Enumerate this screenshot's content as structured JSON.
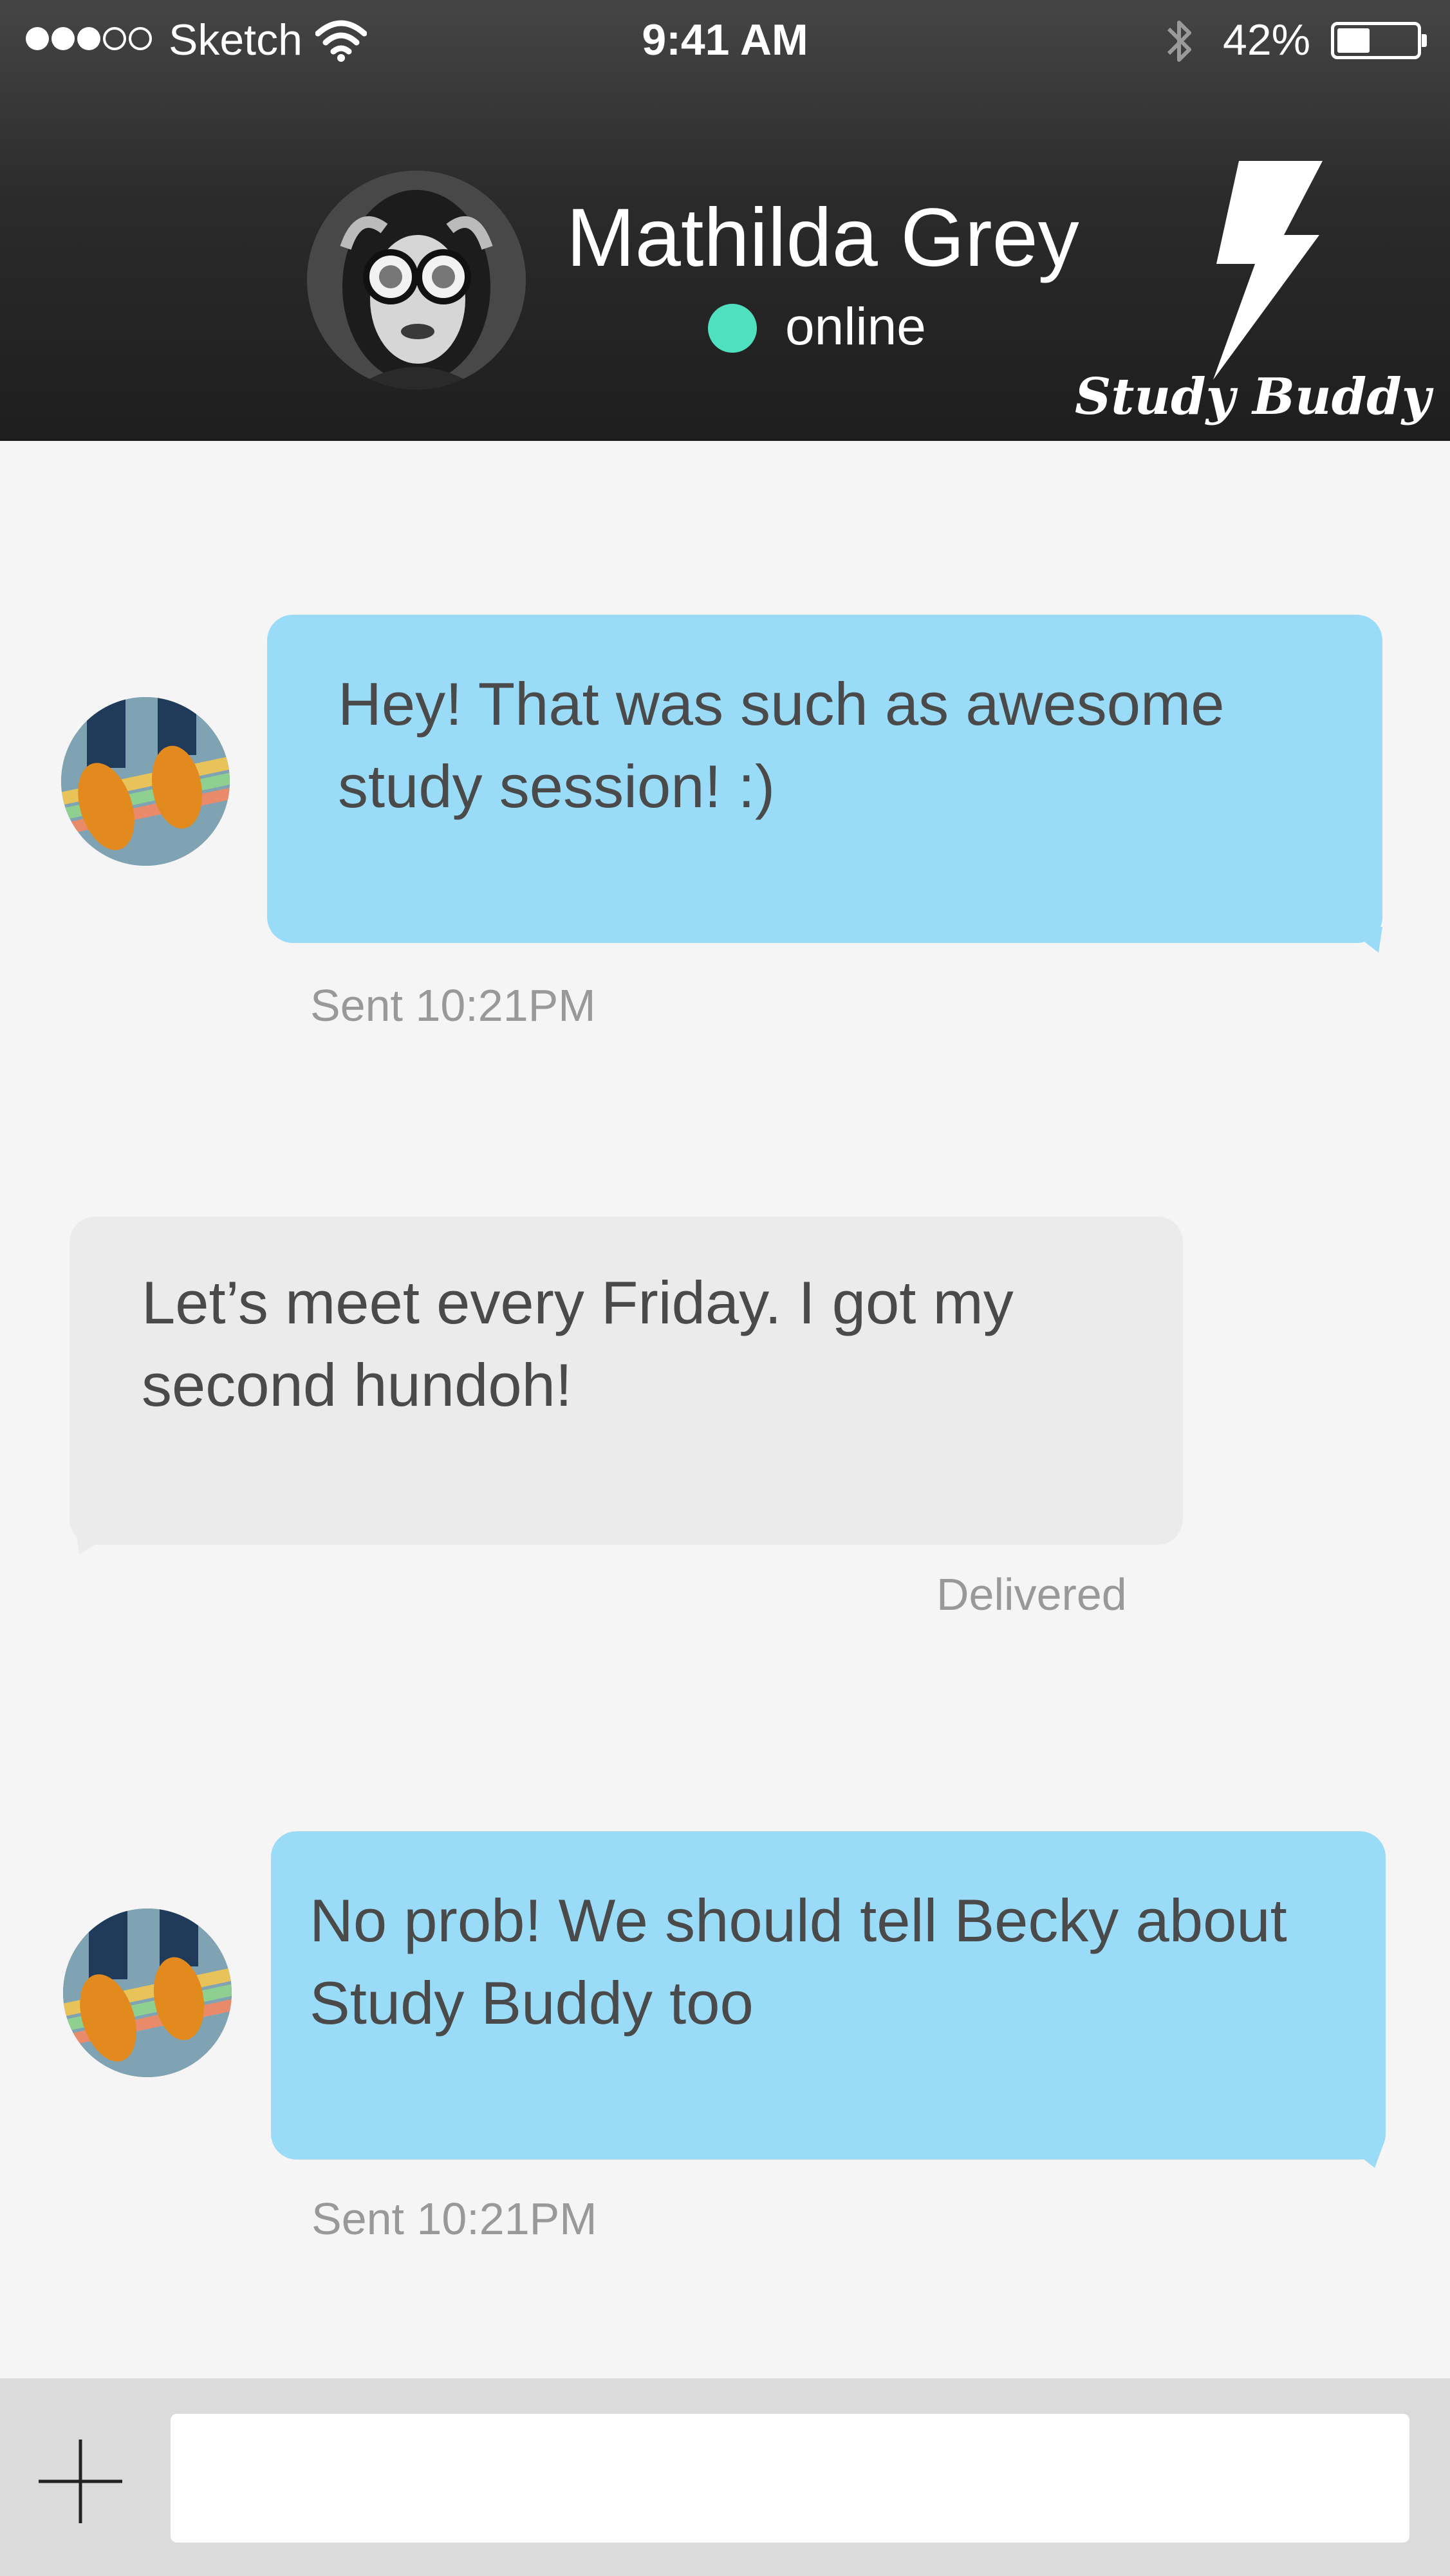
{
  "status_bar": {
    "carrier": "Sketch",
    "time": "9:41 AM",
    "battery": "42%",
    "battery_level": 0.42
  },
  "header": {
    "contact_name": "Mathilda Grey",
    "status": "online",
    "brand": "Study Buddy",
    "status_color": "#4fe0c0"
  },
  "messages": [
    {
      "type": "sent",
      "text": "Hey! That was such as awesome study session! :)",
      "meta": "Sent 10:21PM"
    },
    {
      "type": "received",
      "text": "Let’s meet every Friday. I got my second hundoh!",
      "meta": "Delivered"
    },
    {
      "type": "sent",
      "text": "No prob! We should tell Becky about Study Buddy too",
      "meta": "Sent 10:21PM"
    }
  ],
  "composer": {
    "placeholder": "",
    "add_icon": "plus-icon"
  },
  "colors": {
    "sent_bubble": "#9adcf7",
    "received_bubble": "#ebebeb",
    "header_bg": "#2b2b2b"
  }
}
